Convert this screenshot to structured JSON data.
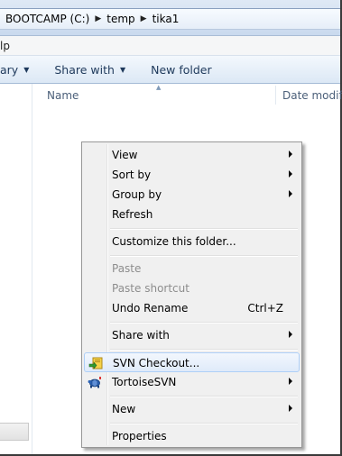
{
  "breadcrumb": {
    "items": [
      "BOOTCAMP (C:)",
      "temp",
      "tika1"
    ]
  },
  "menubar": {
    "partial_label": "lp"
  },
  "toolbar": {
    "library_label": "ary",
    "share_label": "Share with",
    "new_folder_label": "New folder"
  },
  "columns": {
    "name": "Name",
    "date": "Date modifie"
  },
  "context_menu": {
    "view": "View",
    "sort_by": "Sort by",
    "group_by": "Group by",
    "refresh": "Refresh",
    "customize": "Customize this folder...",
    "paste": "Paste",
    "paste_shortcut": "Paste shortcut",
    "undo_rename": "Undo Rename",
    "undo_shortcut": "Ctrl+Z",
    "share_with": "Share with",
    "svn_checkout": "SVN Checkout...",
    "tortoise_svn": "TortoiseSVN",
    "new": "New",
    "properties": "Properties"
  },
  "icons": {
    "svn_checkout": "svn-checkout-icon",
    "tortoise_svn": "tortoise-icon"
  },
  "colors": {
    "hover_border": "#aecff7",
    "menu_bg": "#f0f0f0",
    "toolbar_text": "#1e395b"
  }
}
